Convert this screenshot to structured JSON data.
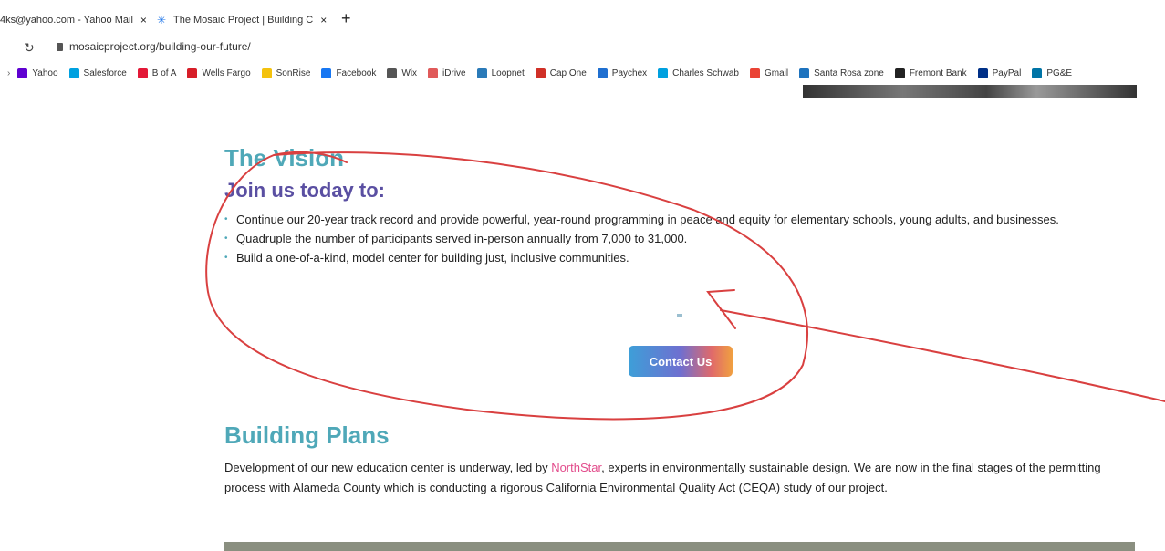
{
  "browser": {
    "tabs": [
      {
        "label": "4ks@yahoo.com - Yahoo Mail",
        "close": "×"
      },
      {
        "label": "The Mosaic Project | Building C",
        "close": "×"
      }
    ],
    "new_tab": "+",
    "url": "mosaicproject.org/building-our-future/",
    "bookmarks": [
      {
        "label": "Yahoo",
        "color": "#5f01d1"
      },
      {
        "label": "Salesforce",
        "color": "#00a1e0"
      },
      {
        "label": "B of A",
        "color": "#e31837"
      },
      {
        "label": "Wells Fargo",
        "color": "#d71e28"
      },
      {
        "label": "SonRise",
        "color": "#f4c20d"
      },
      {
        "label": "Facebook",
        "color": "#1877f2"
      },
      {
        "label": "Wix",
        "color": "#555555"
      },
      {
        "label": "iDrive",
        "color": "#e05a5a"
      },
      {
        "label": "Loopnet",
        "color": "#2a7ab8"
      },
      {
        "label": "Cap One",
        "color": "#d03027"
      },
      {
        "label": "Paychex",
        "color": "#1f6fd0"
      },
      {
        "label": "Charles Schwab",
        "color": "#00a0df"
      },
      {
        "label": "Gmail",
        "color": "#ea4335"
      },
      {
        "label": "Santa Rosa zone",
        "color": "#1e73be"
      },
      {
        "label": "Fremont Bank",
        "color": "#222222"
      },
      {
        "label": "PayPal",
        "color": "#003087"
      },
      {
        "label": "PG&E",
        "color": "#0074a6"
      }
    ]
  },
  "vision": {
    "title": "The Vision",
    "subtitle": "Join us today to:",
    "bullets": [
      "Continue our 20-year track record and provide powerful, year-round programming in peace and equity for elementary schools, young adults, and businesses.",
      "Quadruple the number of participants served in-person annually from 7,000 to 31,000.",
      "Build a one-of-a-kind, model center for building just, inclusive communities."
    ],
    "contact_label": "Contact Us"
  },
  "plans": {
    "title": "Building Plans",
    "text_before": "Development of our new education center is underway, led by ",
    "link": "NorthStar",
    "text_after": ", experts in environmentally sustainable design. We are now in the final stages of the permitting process with Alameda County which is conducting a rigorous California Environmental Quality Act (CEQA) study of our project."
  },
  "colors": {
    "heading": "#4fa8b8",
    "subheading": "#5a4fa2",
    "link": "#e24b8b",
    "annotation": "#d94040"
  }
}
